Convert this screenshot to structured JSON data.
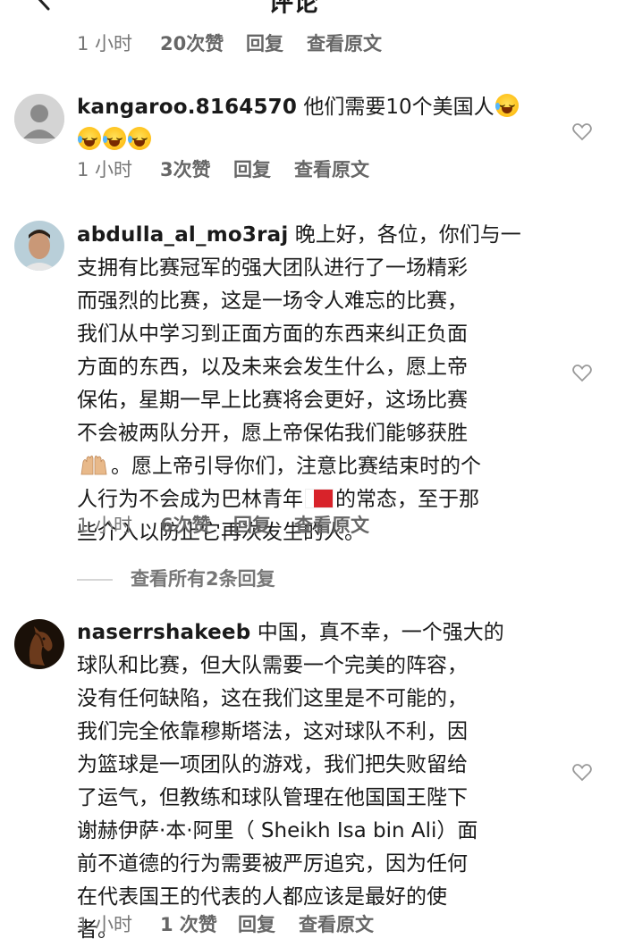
{
  "header": {
    "title": "评论"
  },
  "top_meta": {
    "time": "1 小时",
    "likes": "20次赞",
    "reply": "回复",
    "view_original": "查看原文"
  },
  "comments": [
    {
      "username": "kangaroo.8164570",
      "text": "他们需要10个美国人",
      "meta": {
        "time": "1 小时",
        "likes": "3次赞",
        "reply": "回复",
        "view_original": "查看原文"
      }
    },
    {
      "username": "abdulla_al_mo3raj",
      "lines": [
        "晚上好，各位，你们与一",
        "支拥有比赛冠军的强大团队进行了一场精彩",
        "而强烈的比赛，这是一场令人难忘的比赛，",
        "我们从中学习到正面方面的东西来纠正负面",
        "方面的东西，以及未来会发生什么，愿上帝",
        "保佑，星期一早上比赛将会更好，这场比赛",
        "不会被两队分开，愿上帝保佑我们能够获胜",
        "。愿上帝引导你们，注意比赛结束时的个",
        "人行为不会成为巴林青年",
        "的常态，至于那",
        "些介入以防止它再次发生的人。"
      ],
      "meta": {
        "time": "1 小时",
        "likes": "6次赞",
        "reply": "回复",
        "view_original": "查看原文"
      },
      "view_replies": "查看所有2条回复"
    },
    {
      "username": "naserrshakeeb",
      "lines": [
        "中国，真不幸，一个强大的",
        "球队和比赛，但大队需要一个完美的阵容，",
        "没有任何缺陷，这在我们这里是不可能的，",
        "我们完全依靠穆斯塔法，这对球队不利，因",
        "为篮球是一项团队的游戏，我们把失败留给",
        "了运气，但教练和球队管理在他国国王陛下",
        "谢赫伊萨·本·阿里（ Sheikh Isa bin Ali）面",
        "前不道德的行为需要被严厉追究，因为任何",
        "在代表国王的代表的人都应该是最好的使",
        "者。"
      ],
      "meta": {
        "time": "1 小时",
        "likes": "1 次赞",
        "reply": "回复",
        "view_original": "查看原文"
      }
    }
  ],
  "icons": {
    "back": "back-arrow-icon",
    "like": "heart-icon",
    "avatar_default": "default-avatar-icon"
  },
  "colors": {
    "meta_text": "#777777",
    "heart_stroke": "#9a9a9a",
    "avatar_bg": "#c9c9c9"
  }
}
